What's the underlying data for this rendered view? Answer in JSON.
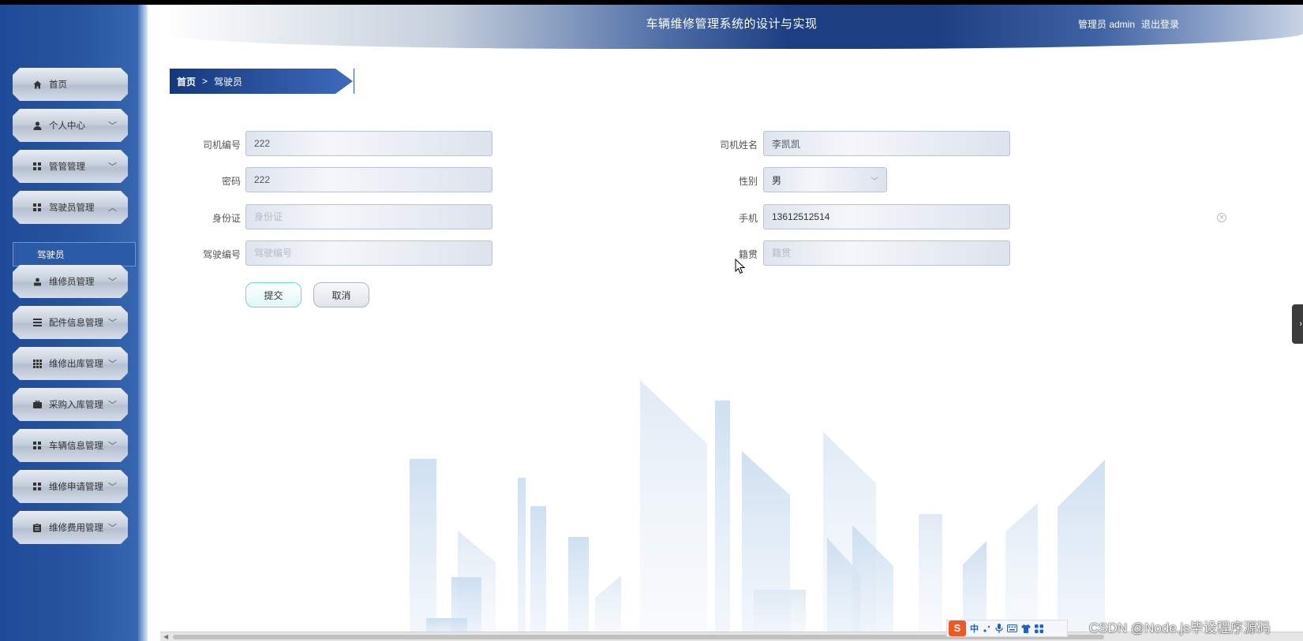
{
  "header": {
    "title": "车辆维修管理系统的设计与实现",
    "user_label": "管理员 admin",
    "logout_label": "退出登录"
  },
  "sidebar": {
    "items": [
      {
        "label": "首页",
        "icon": "home-icon",
        "expanded": false,
        "has_chevron": false
      },
      {
        "label": "个人中心",
        "icon": "user-icon",
        "expanded": false,
        "has_chevron": true
      },
      {
        "label": "管管管理",
        "icon": "grid-icon",
        "expanded": false,
        "has_chevron": true
      },
      {
        "label": "驾驶员管理",
        "icon": "grid-icon",
        "expanded": true,
        "has_chevron": true
      },
      {
        "label": "维修员管理",
        "icon": "worker-icon",
        "expanded": false,
        "has_chevron": true
      },
      {
        "label": "配件信息管理",
        "icon": "list-icon",
        "expanded": false,
        "has_chevron": true
      },
      {
        "label": "维修出库管理",
        "icon": "apps-icon",
        "expanded": false,
        "has_chevron": true
      },
      {
        "label": "采购入库管理",
        "icon": "briefcase-icon",
        "expanded": false,
        "has_chevron": true
      },
      {
        "label": "车辆信息管理",
        "icon": "grid-icon",
        "expanded": false,
        "has_chevron": true
      },
      {
        "label": "维修申请管理",
        "icon": "grid-icon",
        "expanded": false,
        "has_chevron": true
      },
      {
        "label": "维修费用管理",
        "icon": "clipboard-icon",
        "expanded": false,
        "has_chevron": true
      }
    ],
    "sub_item_label": "驾驶员"
  },
  "breadcrumb": {
    "home": "首页",
    "separator": ">",
    "current": "驾驶员"
  },
  "form": {
    "driver_no": {
      "label": "司机编号",
      "value": "222",
      "placeholder": "司机编号"
    },
    "driver_name": {
      "label": "司机姓名",
      "value": "李凯凯",
      "placeholder": "司机姓名"
    },
    "password": {
      "label": "密码",
      "value": "222",
      "placeholder": "密码"
    },
    "gender": {
      "label": "性别",
      "value": "男"
    },
    "id_card": {
      "label": "身份证",
      "value": "",
      "placeholder": "身份证"
    },
    "phone": {
      "label": "手机",
      "value": "13612512514",
      "placeholder": "手机"
    },
    "license_no": {
      "label": "驾驶编号",
      "value": "",
      "placeholder": "驾驶编号"
    },
    "native_place": {
      "label": "籍贯",
      "value": "",
      "placeholder": "籍贯"
    }
  },
  "buttons": {
    "submit": "提交",
    "cancel": "取消"
  },
  "ime": {
    "logo": "S",
    "mode": "中"
  },
  "watermark": "CSDN @Node.js毕设程序源码",
  "colors": {
    "sidebar_bg": "#27559f",
    "header_accent": "#1d3f82",
    "submit_border": "#6ed6dc"
  }
}
